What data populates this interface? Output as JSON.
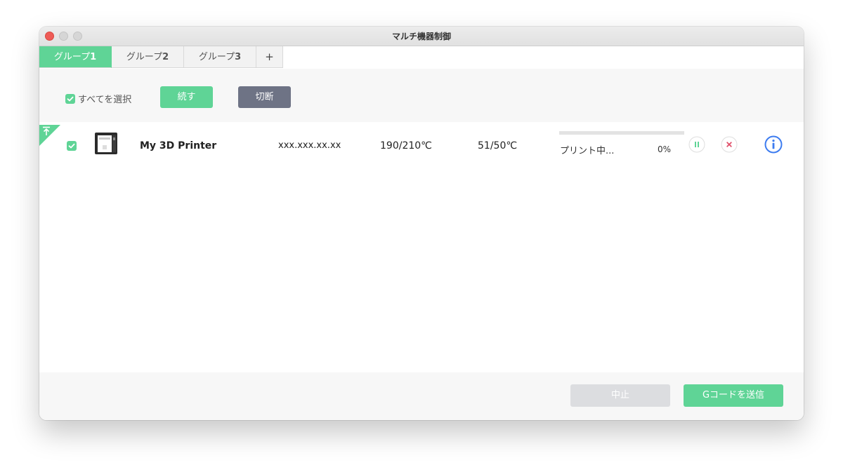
{
  "window": {
    "title": "マルチ機器制御"
  },
  "tabs": [
    {
      "label": "グループ",
      "num": "1",
      "active": true
    },
    {
      "label": "グループ",
      "num": "2",
      "active": false
    },
    {
      "label": "グループ",
      "num": "3",
      "active": false
    }
  ],
  "tabs_add_label": "+",
  "toolbar": {
    "select_all_label": "すべてを選択",
    "resume_label": "続す",
    "disconnect_label": "切断"
  },
  "printers": [
    {
      "name": "My 3D Printer",
      "ip": "xxx.xxx.xx.xx",
      "nozzle_temp": "190/210℃",
      "bed_temp": "51/50℃",
      "status": "プリント中...",
      "progress_text": "0%",
      "progress": 0
    }
  ],
  "footer": {
    "stop_label": "中止",
    "send_label": "Gコードを送信"
  },
  "colors": {
    "accent": "#5fd496",
    "dark_button": "#6e7385",
    "disabled_button": "#dcdde0",
    "info_blue": "#3d7cf0",
    "cancel_red": "#e0506a"
  }
}
